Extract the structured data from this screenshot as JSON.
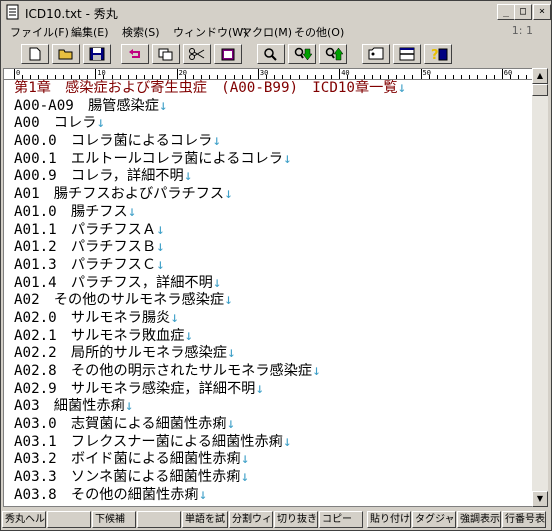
{
  "window": {
    "title": "ICD10.txt - 秀丸",
    "minimize_glyph": "_",
    "maximize_glyph": "□",
    "close_glyph": "×"
  },
  "menu": {
    "items": [
      "ファイル(F)",
      "編集(E)",
      "検索(S)",
      "ウィンドウ(W)",
      "マクロ(M)",
      "その他(O)"
    ],
    "cursor_position": "1: 1"
  },
  "toolbar": {
    "buttons": [
      "new-file",
      "open-folder",
      "save",
      "undo",
      "copy",
      "cut",
      "paste",
      "find",
      "find-down",
      "find-up",
      "tag-jump",
      "split-window",
      "help"
    ]
  },
  "ruler": {
    "labels": [
      "0",
      "10",
      "20",
      "30",
      "40",
      "50",
      "60"
    ]
  },
  "editor": {
    "eol_mark": "↓",
    "lines": [
      "第1章　感染症および寄生虫症　(A00-B99)　ICD10章一覧",
      "A00-A09　腸管感染症",
      "A00　コレラ",
      "A00.0　コレラ菌によるコレラ",
      "A00.1　エルトールコレラ菌によるコレラ",
      "A00.9　コレラ，詳細不明",
      "A01　腸チフスおよびパラチフス",
      "A01.0　腸チフス",
      "A01.1　パラチフスＡ",
      "A01.2　パラチフスＢ",
      "A01.3　パラチフスＣ",
      "A01.4　パラチフス，詳細不明",
      "A02　その他のサルモネラ感染症",
      "A02.0　サルモネラ腸炎",
      "A02.1　サルモネラ敗血症",
      "A02.2　局所的サルモネラ感染症",
      "A02.8　その他の明示されたサルモネラ感染症",
      "A02.9　サルモネラ感染症，詳細不明",
      "A03　細菌性赤痢",
      "A03.0　志賀菌による細菌性赤痢",
      "A03.1　フレクスナー菌による細菌性赤痢",
      "A03.2　ボイド菌による細菌性赤痢",
      "A03.3　ソンネ菌による細菌性赤痢",
      "A03.8　その他の細菌性赤痢"
    ]
  },
  "statusbar": {
    "keys": [
      "秀丸ヘルプ",
      "",
      "下候補",
      "",
      "単語を試",
      "分割ウィン",
      "切り抜き",
      "コピー",
      "",
      "貼り付け",
      "タグジャンプ",
      "強調表示",
      "行番号表"
    ]
  },
  "colors": {
    "heading": "#800000",
    "eol": "#3fa0c8",
    "background": "#d4d0c8"
  }
}
